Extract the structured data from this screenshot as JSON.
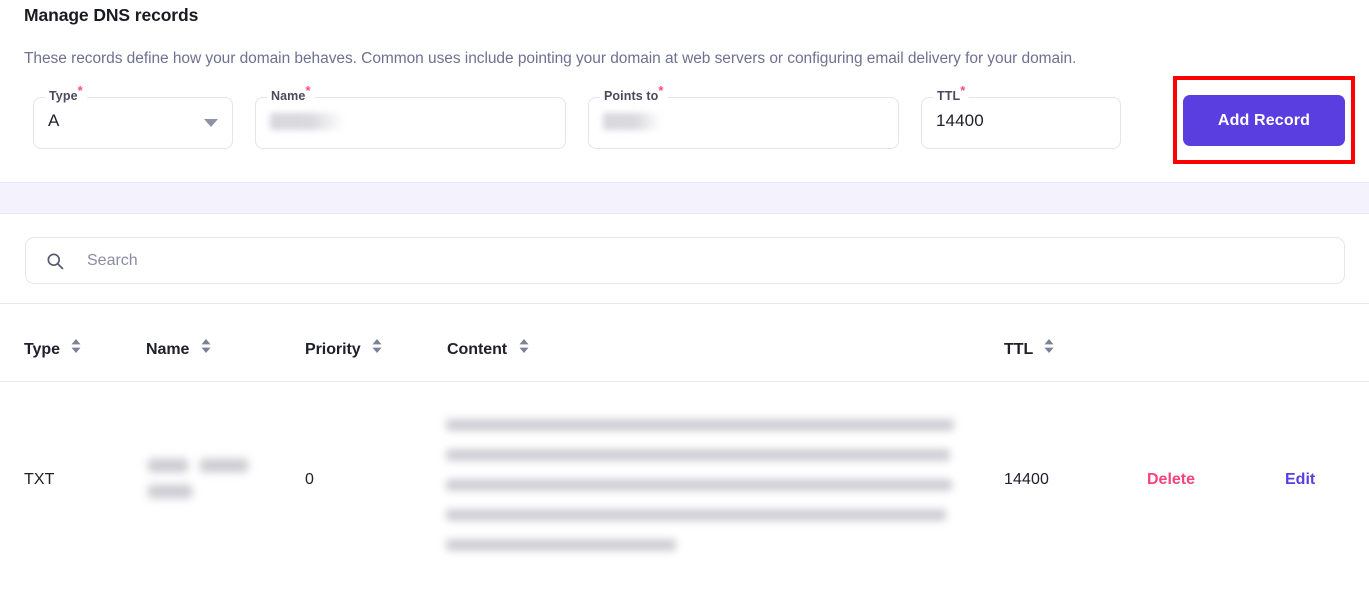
{
  "header": {
    "title": "Manage DNS records",
    "description": "These records define how your domain behaves. Common uses include pointing your domain at web servers or configuring email delivery for your domain."
  },
  "form": {
    "type": {
      "label": "Type",
      "required_marker": "*",
      "value": "A",
      "icon": "chevron-down-icon"
    },
    "name": {
      "label": "Name",
      "required_marker": "*",
      "value": ""
    },
    "points_to": {
      "label": "Points to",
      "required_marker": "*",
      "value": ""
    },
    "ttl": {
      "label": "TTL",
      "required_marker": "*",
      "value": "14400"
    },
    "add_record_label": "Add Record"
  },
  "search": {
    "placeholder": "Search",
    "value": "",
    "icon": "search-icon"
  },
  "table": {
    "columns": [
      {
        "key": "type",
        "label": "Type",
        "sortable": true
      },
      {
        "key": "name",
        "label": "Name",
        "sortable": true
      },
      {
        "key": "priority",
        "label": "Priority",
        "sortable": true
      },
      {
        "key": "content",
        "label": "Content",
        "sortable": true
      },
      {
        "key": "ttl",
        "label": "TTL",
        "sortable": true
      }
    ],
    "rows": [
      {
        "type": "TXT",
        "name": "",
        "priority": "0",
        "content": "",
        "ttl": "14400",
        "delete_label": "Delete",
        "edit_label": "Edit"
      }
    ]
  },
  "colors": {
    "accent_purple": "#5b3ee0",
    "delete_pink": "#f8447a",
    "highlight_red": "#ff0000",
    "required_asterisk": "#ff4d7d",
    "band_lavender": "#f3f2fd",
    "text_primary": "#20202c",
    "text_muted": "#6e7191"
  }
}
